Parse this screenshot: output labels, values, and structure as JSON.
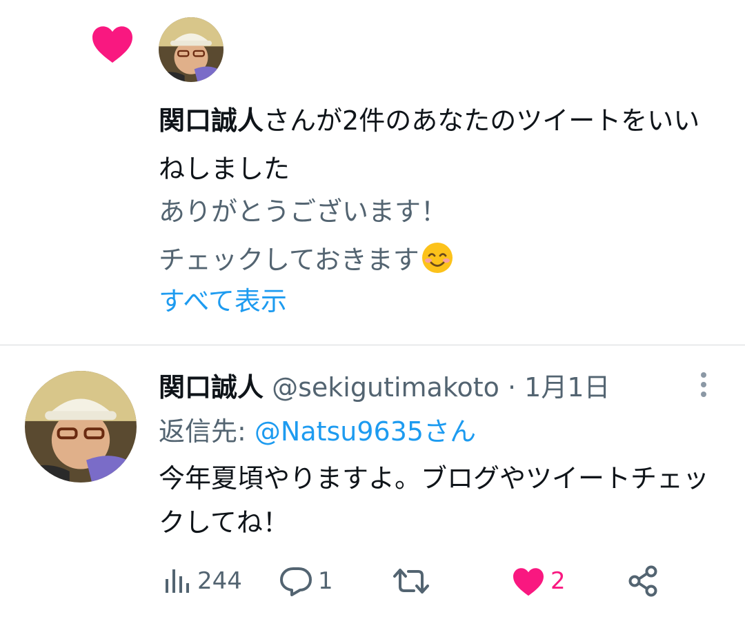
{
  "notification": {
    "actor_name": "関口誠人",
    "action_text": "さんが2件のあなたのツイートをいいねしました",
    "preview_line1": "ありがとうございます！",
    "preview_line2": "チェックしておきます",
    "preview_emoji": "smiling-face-icon",
    "show_all_label": "すべて表示",
    "heart_color": "#f91880"
  },
  "tweet": {
    "display_name": "関口誠人",
    "handle": "@sekigutimakoto",
    "separator": "·",
    "date": "1月1日",
    "reply_prefix": "返信先: ",
    "reply_mention": "@Natsu9635さん",
    "text": "今年夏頃やりますよ。ブログやツイートチェックしてね！",
    "stats": {
      "views": "244",
      "replies": "1",
      "likes": "2"
    },
    "liked": true,
    "like_color": "#f91880"
  },
  "colors": {
    "text": "#0f1419",
    "secondary": "#536471",
    "link": "#1d9bf0",
    "divider": "#d6d9db"
  }
}
